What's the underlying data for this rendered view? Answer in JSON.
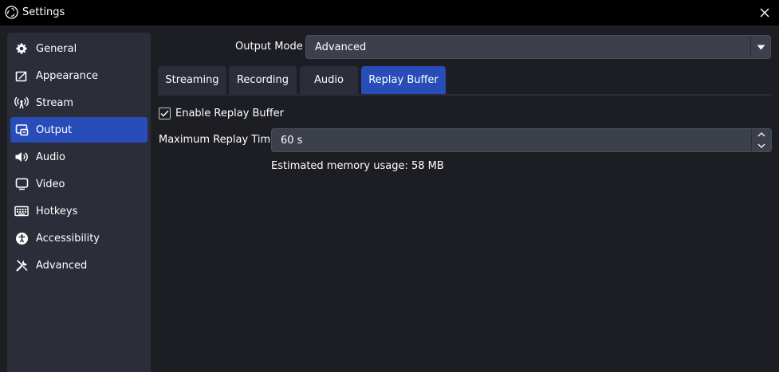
{
  "window": {
    "title": "Settings",
    "app_icon": "obs-logo-icon",
    "close_icon": "close-icon"
  },
  "sidebar": {
    "items": [
      {
        "label": "General",
        "icon": "gear-icon",
        "active": false
      },
      {
        "label": "Appearance",
        "icon": "appearance-icon",
        "active": false
      },
      {
        "label": "Stream",
        "icon": "broadcast-icon",
        "active": false
      },
      {
        "label": "Output",
        "icon": "output-icon",
        "active": true
      },
      {
        "label": "Audio",
        "icon": "speaker-icon",
        "active": false
      },
      {
        "label": "Video",
        "icon": "monitor-icon",
        "active": false
      },
      {
        "label": "Hotkeys",
        "icon": "keyboard-icon",
        "active": false
      },
      {
        "label": "Accessibility",
        "icon": "accessibility-icon",
        "active": false
      },
      {
        "label": "Advanced",
        "icon": "tools-icon",
        "active": false
      }
    ]
  },
  "output_mode": {
    "label": "Output Mode",
    "value": "Advanced"
  },
  "tabs": [
    {
      "label": "Streaming",
      "active": false
    },
    {
      "label": "Recording",
      "active": false
    },
    {
      "label": "Audio",
      "active": false
    },
    {
      "label": "Replay Buffer",
      "active": true
    }
  ],
  "replay_buffer": {
    "enable_label": "Enable Replay Buffer",
    "enabled": true,
    "max_time_label": "Maximum Replay Time",
    "max_time_value": "60 s",
    "memory_text": "Estimated memory usage: 58 MB"
  },
  "colors": {
    "accent": "#284cb8",
    "background": "#1d1e24",
    "panel": "#2b2e38",
    "input": "#3c404b",
    "titlebar": "#000000"
  }
}
